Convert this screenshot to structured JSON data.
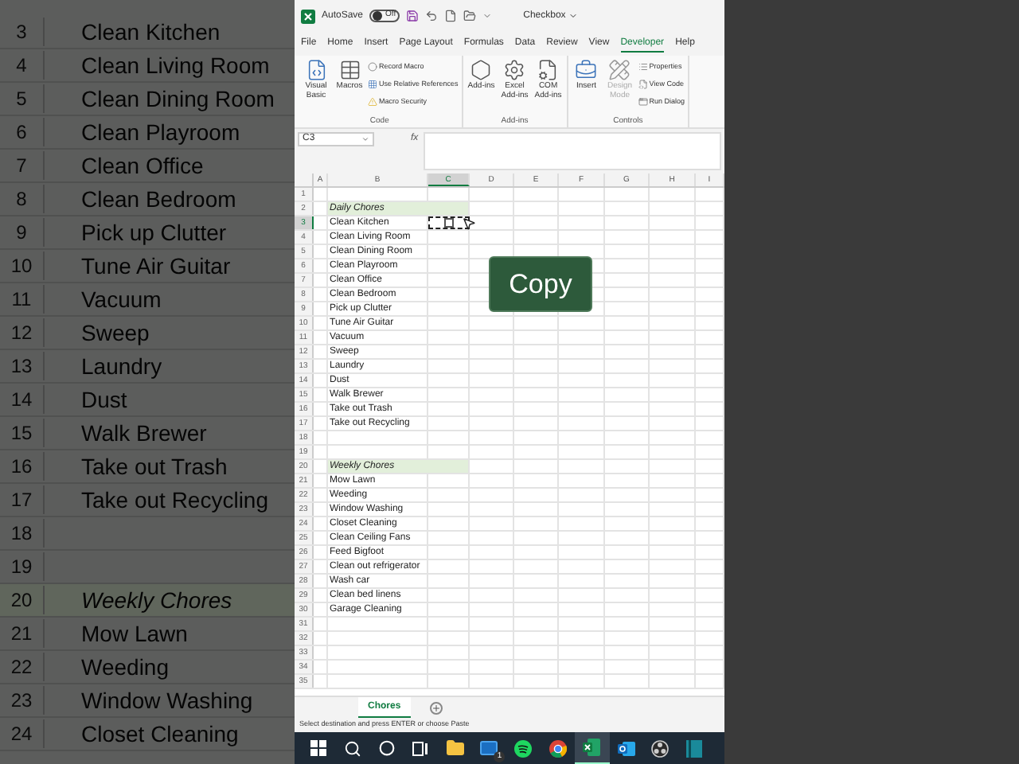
{
  "background_zoom": {
    "rows": [
      {
        "number": "3",
        "text": "Clean Kitchen",
        "kind": "item"
      },
      {
        "number": "4",
        "text": "Clean Living Room",
        "kind": "item"
      },
      {
        "number": "5",
        "text": "Clean Dining Room",
        "kind": "item"
      },
      {
        "number": "6",
        "text": "Clean Playroom",
        "kind": "item"
      },
      {
        "number": "7",
        "text": "Clean Office",
        "kind": "item"
      },
      {
        "number": "8",
        "text": "Clean Bedroom",
        "kind": "item"
      },
      {
        "number": "9",
        "text": "Pick up Clutter",
        "kind": "item"
      },
      {
        "number": "10",
        "text": "Tune Air Guitar",
        "kind": "item"
      },
      {
        "number": "11",
        "text": "Vacuum",
        "kind": "item"
      },
      {
        "number": "12",
        "text": "Sweep",
        "kind": "item"
      },
      {
        "number": "13",
        "text": "Laundry",
        "kind": "item"
      },
      {
        "number": "14",
        "text": "Dust",
        "kind": "item"
      },
      {
        "number": "15",
        "text": "Walk Brewer",
        "kind": "item"
      },
      {
        "number": "16",
        "text": "Take out Trash",
        "kind": "item"
      },
      {
        "number": "17",
        "text": "Take out Recycling",
        "kind": "item"
      },
      {
        "number": "18",
        "kind": "blank"
      },
      {
        "number": "19",
        "kind": "blank"
      },
      {
        "number": "20",
        "text": "Weekly Chores",
        "kind": "heading"
      },
      {
        "number": "21",
        "text": "Mow Lawn",
        "kind": "item"
      },
      {
        "number": "22",
        "text": "Weeding",
        "kind": "item"
      },
      {
        "number": "23",
        "text": "Window Washing",
        "kind": "item"
      },
      {
        "number": "24",
        "text": "Closet Cleaning",
        "kind": "item"
      }
    ]
  },
  "window": {
    "autosave_label": "AutoSave",
    "autosave_state": "Off",
    "autosave_on": false,
    "file_title": "Checkbox"
  },
  "menu_tabs": [
    {
      "label": "File",
      "selected": false
    },
    {
      "label": "Home",
      "selected": false
    },
    {
      "label": "Insert",
      "selected": false
    },
    {
      "label": "Page Layout",
      "selected": false
    },
    {
      "label": "Formulas",
      "selected": false
    },
    {
      "label": "Data",
      "selected": false
    },
    {
      "label": "Review",
      "selected": false
    },
    {
      "label": "View",
      "selected": false
    },
    {
      "label": "Developer",
      "selected": true
    },
    {
      "label": "Help",
      "selected": false
    }
  ],
  "ribbon_groups": [
    {
      "label": "Code",
      "items": [
        {
          "kind": "large",
          "label": "Visual Basic",
          "disabled": false
        },
        {
          "kind": "large",
          "label": "Macros",
          "disabled": false
        },
        {
          "kind": "stack",
          "items": [
            {
              "label": "Record Macro"
            },
            {
              "label": "Use Relative References"
            },
            {
              "label": "Macro Security"
            }
          ]
        }
      ]
    },
    {
      "label": "Add-ins",
      "items": [
        {
          "kind": "large",
          "label": "Add-ins",
          "disabled": false
        },
        {
          "kind": "large",
          "label": "Excel Add-ins",
          "disabled": false
        },
        {
          "kind": "large",
          "label": "COM Add-ins",
          "disabled": false
        }
      ]
    },
    {
      "label": "Controls",
      "items": [
        {
          "kind": "large",
          "label": "Insert",
          "disabled": false
        },
        {
          "kind": "large",
          "label": "Design Mode",
          "disabled": true
        },
        {
          "kind": "stack",
          "items": [
            {
              "label": "Properties"
            },
            {
              "label": "View Code"
            },
            {
              "label": "Run Dialog"
            }
          ]
        }
      ]
    }
  ],
  "name_box": "C3",
  "formula_label": "fx",
  "columns": [
    {
      "label": "A",
      "selected": false
    },
    {
      "label": "B",
      "selected": false
    },
    {
      "label": "C",
      "selected": true
    },
    {
      "label": "D",
      "selected": false
    },
    {
      "label": "E",
      "selected": false
    },
    {
      "label": "F",
      "selected": false
    },
    {
      "label": "G",
      "selected": false
    },
    {
      "label": "H",
      "selected": false
    },
    {
      "label": "I",
      "selected": false
    }
  ],
  "rows": [
    {
      "number": "1",
      "kind": "blank",
      "selected": false
    },
    {
      "number": "2",
      "kind": "heading",
      "text": "Daily Chores",
      "selected": false
    },
    {
      "number": "3",
      "kind": "item",
      "text": "Clean Kitchen",
      "selected": true,
      "c_checkbox": {
        "checked": false
      },
      "copy_marquee": true
    },
    {
      "number": "4",
      "kind": "item",
      "text": "Clean Living Room",
      "selected": false
    },
    {
      "number": "5",
      "kind": "item",
      "text": "Clean Dining Room",
      "selected": false
    },
    {
      "number": "6",
      "kind": "item",
      "text": "Clean Playroom",
      "selected": false
    },
    {
      "number": "7",
      "kind": "item",
      "text": "Clean Office",
      "selected": false
    },
    {
      "number": "8",
      "kind": "item",
      "text": "Clean Bedroom",
      "selected": false
    },
    {
      "number": "9",
      "kind": "item",
      "text": "Pick up Clutter",
      "selected": false
    },
    {
      "number": "10",
      "kind": "item",
      "text": "Tune Air Guitar",
      "selected": false
    },
    {
      "number": "11",
      "kind": "item",
      "text": "Vacuum",
      "selected": false
    },
    {
      "number": "12",
      "kind": "item",
      "text": "Sweep",
      "selected": false
    },
    {
      "number": "13",
      "kind": "item",
      "text": "Laundry",
      "selected": false
    },
    {
      "number": "14",
      "kind": "item",
      "text": "Dust",
      "selected": false
    },
    {
      "number": "15",
      "kind": "item",
      "text": "Walk Brewer",
      "selected": false
    },
    {
      "number": "16",
      "kind": "item",
      "text": "Take out Trash",
      "selected": false
    },
    {
      "number": "17",
      "kind": "item",
      "text": "Take out Recycling",
      "selected": false
    },
    {
      "number": "18",
      "kind": "blank",
      "selected": false
    },
    {
      "number": "19",
      "kind": "blank",
      "selected": false
    },
    {
      "number": "20",
      "kind": "heading",
      "text": "Weekly Chores",
      "selected": false
    },
    {
      "number": "21",
      "kind": "item",
      "text": "Mow Lawn",
      "selected": false
    },
    {
      "number": "22",
      "kind": "item",
      "text": "Weeding",
      "selected": false
    },
    {
      "number": "23",
      "kind": "item",
      "text": "Window Washing",
      "selected": false
    },
    {
      "number": "24",
      "kind": "item",
      "text": "Closet Cleaning",
      "selected": false
    },
    {
      "number": "25",
      "kind": "item",
      "text": "Clean Ceiling Fans",
      "selected": false
    },
    {
      "number": "26",
      "kind": "item",
      "text": "Feed Bigfoot",
      "selected": false
    },
    {
      "number": "27",
      "kind": "item",
      "text": "Clean out refrigerator",
      "selected": false
    },
    {
      "number": "28",
      "kind": "item",
      "text": "Wash car",
      "selected": false
    },
    {
      "number": "29",
      "kind": "item",
      "text": "Clean bed linens",
      "selected": false
    },
    {
      "number": "30",
      "kind": "item",
      "text": "Garage Cleaning",
      "selected": false
    },
    {
      "number": "31",
      "kind": "blank",
      "selected": false
    },
    {
      "number": "32",
      "kind": "blank",
      "selected": false
    },
    {
      "number": "33",
      "kind": "blank",
      "selected": false
    },
    {
      "number": "34",
      "kind": "blank",
      "selected": false
    },
    {
      "number": "35",
      "kind": "blank",
      "selected": false
    }
  ],
  "overlay_label": "Copy",
  "sheet_tabs": [
    {
      "label": "Chores",
      "selected": true
    }
  ],
  "status_bar": "Select destination and press ENTER or choose Paste",
  "taskbar": [
    {
      "kind": "start",
      "selected": false
    },
    {
      "kind": "search",
      "selected": false
    },
    {
      "kind": "cortana",
      "selected": false
    },
    {
      "kind": "taskview",
      "selected": false
    },
    {
      "kind": "explorer",
      "selected": false
    },
    {
      "kind": "mail",
      "badge": "1",
      "selected": false
    },
    {
      "kind": "spotify",
      "selected": false
    },
    {
      "kind": "chrome",
      "selected": false
    },
    {
      "kind": "excel",
      "selected": true
    },
    {
      "kind": "outlook",
      "selected": false
    },
    {
      "kind": "obs",
      "selected": false
    },
    {
      "kind": "app",
      "selected": false
    }
  ]
}
